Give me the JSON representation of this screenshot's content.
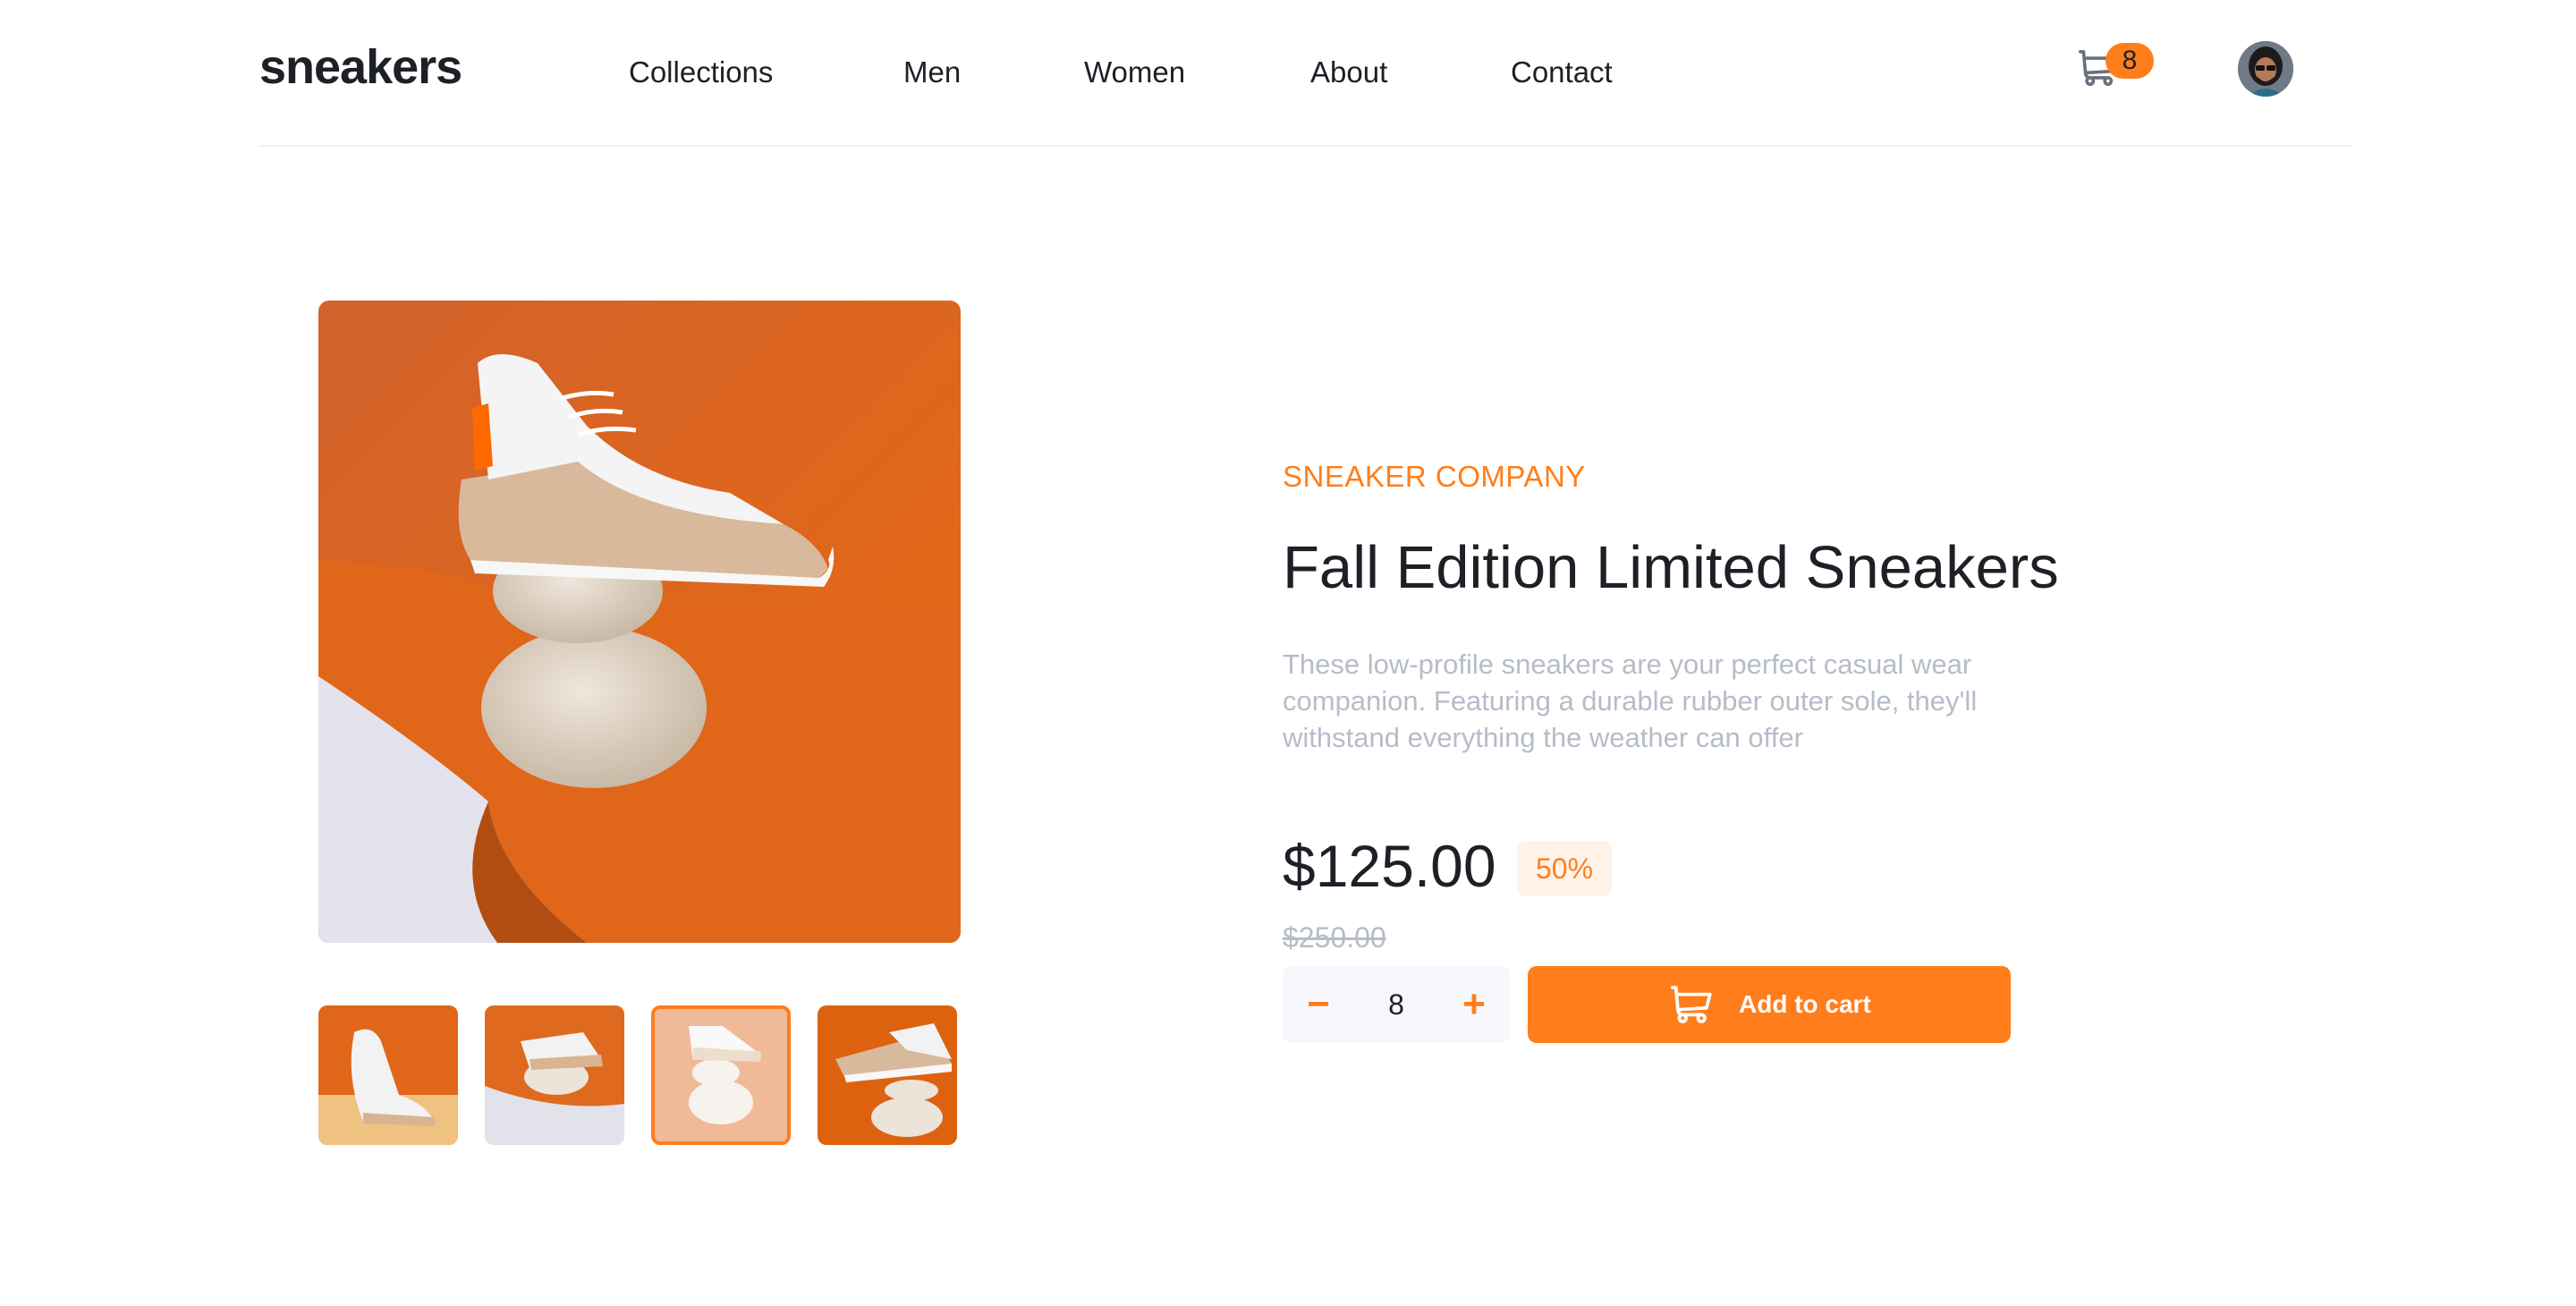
{
  "header": {
    "logo": "sneakers",
    "nav": [
      "Collections",
      "Men",
      "Women",
      "About",
      "Contact"
    ],
    "cart_count": "8",
    "cart_icon": "cart-icon",
    "avatar_icon": "user-avatar"
  },
  "product": {
    "company": "SNEAKER COMPANY",
    "title": "Fall Edition Limited Sneakers",
    "description": "These low-profile sneakers are your perfect casual wear companion. Featuring a durable rubber outer sole, they'll withstand everything the weather can offer",
    "price": "$125.00",
    "discount": "50%",
    "original_price": "$250.00",
    "quantity": "8",
    "minus_symbol": "−",
    "plus_symbol": "+",
    "add_to_cart_label": "Add to cart"
  },
  "gallery": {
    "thumbnail_count": 4,
    "active_thumbnail": 3
  },
  "colors": {
    "accent": "#ff7e1b",
    "accent_light": "#fff2e8",
    "text_dark": "#1d2026",
    "text_muted": "#b6bcc8",
    "light_bg": "#f6f8fd"
  }
}
